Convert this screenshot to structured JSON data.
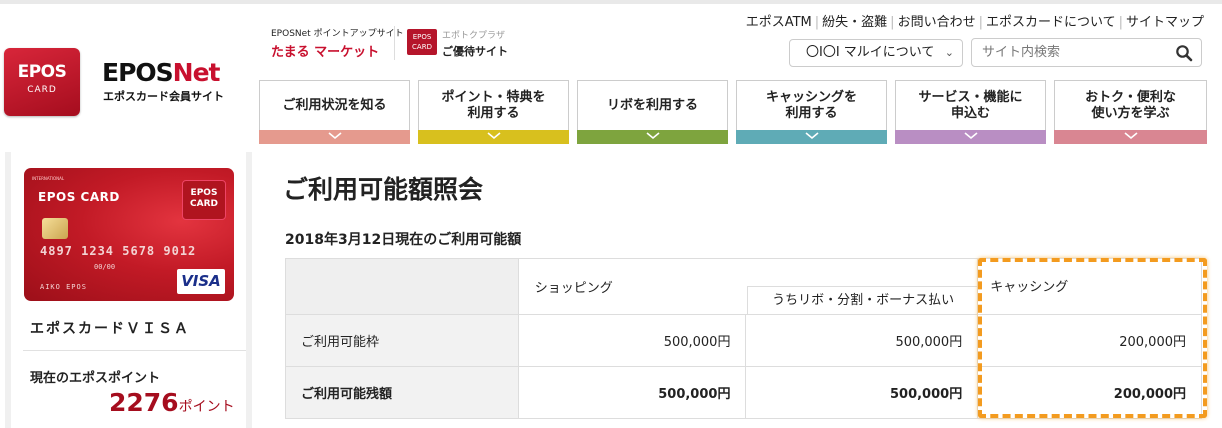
{
  "header": {
    "logo": {
      "line1": "EPOS",
      "line2": "CARD"
    },
    "brand": {
      "part1": "EPOS",
      "part2": "Net",
      "sub": "エポスカード会員サイト"
    },
    "promo1": {
      "line1": "EPOSNet ポイントアップサイト",
      "line2": "たまる マーケット"
    },
    "promo2": {
      "icon_line1": "EPOS",
      "icon_line2": "CARD",
      "line1": "エポトクプラザ",
      "line2": "ご優待サイト"
    },
    "top_links": [
      "エポスATM",
      "紛失・盗難",
      "お問い合わせ",
      "エポスカードについて",
      "サイトマップ"
    ],
    "marui_select": "〇I〇I マルイについて",
    "search": {
      "placeholder": "サイト内検索",
      "icon": "search-icon"
    }
  },
  "nav": [
    {
      "label": "ご利用状況を知る",
      "color": "#e59a8e"
    },
    {
      "label": "ポイント・特典を\n利用する",
      "color": "#d8c01e"
    },
    {
      "label": "リボを利用する",
      "color": "#7ea43e"
    },
    {
      "label": "キャッシングを\n利用する",
      "color": "#5fabb6"
    },
    {
      "label": "サービス・機能に\n申込む",
      "color": "#b98ec3"
    },
    {
      "label": "おトク・便利な\n使い方を学ぶ",
      "color": "#d98692"
    }
  ],
  "sidebar": {
    "card": {
      "intl": "INTERNATIONAL",
      "name": "EPOS CARD",
      "mini_line1": "EPOS",
      "mini_line2": "CARD",
      "number": "4897 1234 5678 9012",
      "expiry": "00/00",
      "holder": "AIKO EPOS",
      "brand": "VISA"
    },
    "card_name": "エポスカードＶＩＳＡ",
    "points_label": "現在のエポスポイント",
    "points_value": "2276",
    "points_unit": "ポイント"
  },
  "main": {
    "title": "ご利用可能額照会",
    "subtitle": "2018年3月12日現在のご利用可能額",
    "table": {
      "col_shopping": "ショッピング",
      "col_revo": "うちリボ・分割・ボーナス払い",
      "col_cashing": "キャッシング",
      "rows": [
        {
          "label": "ご利用可能枠",
          "shopping": "500,000円",
          "revo": "500,000円",
          "cashing": "200,000円"
        },
        {
          "label": "ご利用可能残額",
          "shopping": "500,000円",
          "revo": "500,000円",
          "cashing": "200,000円"
        }
      ]
    },
    "highlight_color": "#f39b1f"
  }
}
